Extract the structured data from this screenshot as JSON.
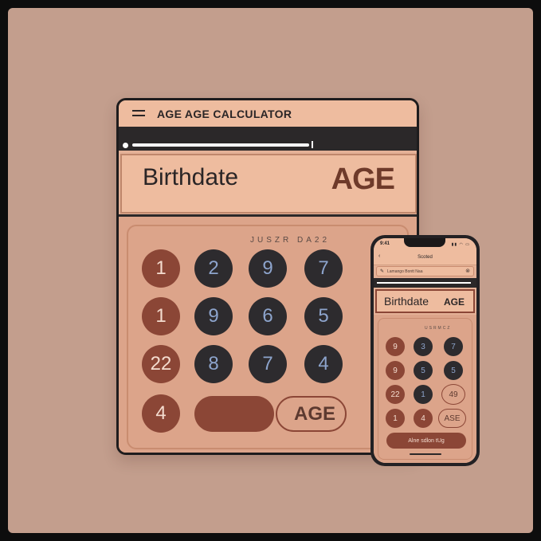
{
  "tablet": {
    "title": "AGE AGE CALCULATOR",
    "display_label": "Birthdate",
    "display_age": "AGE",
    "keypad_label": "JUSZR DA22",
    "keys": [
      "1",
      "2",
      "9",
      "7",
      "1",
      "9",
      "6",
      "5",
      "22",
      "8",
      "7",
      "4",
      "4"
    ],
    "age_button": "AGE"
  },
  "phone": {
    "time": "9:41",
    "nav_title": "Scoted",
    "url_text": "Lamango Bontt Naa",
    "display_label": "Birthdate",
    "display_age": "AGE",
    "keypad_label": "USRMCZ",
    "keys": [
      "9",
      "3",
      "7",
      "9",
      "5",
      "5",
      "22",
      "1",
      "1",
      "4"
    ],
    "age_49": "49",
    "age_button": "ASE",
    "result_button": "Alne sdlon tUg"
  },
  "colors": {
    "background": "#c39e8d",
    "brown": "#8b4636",
    "dark": "#2d2b2e",
    "panel": "#e4b197"
  }
}
